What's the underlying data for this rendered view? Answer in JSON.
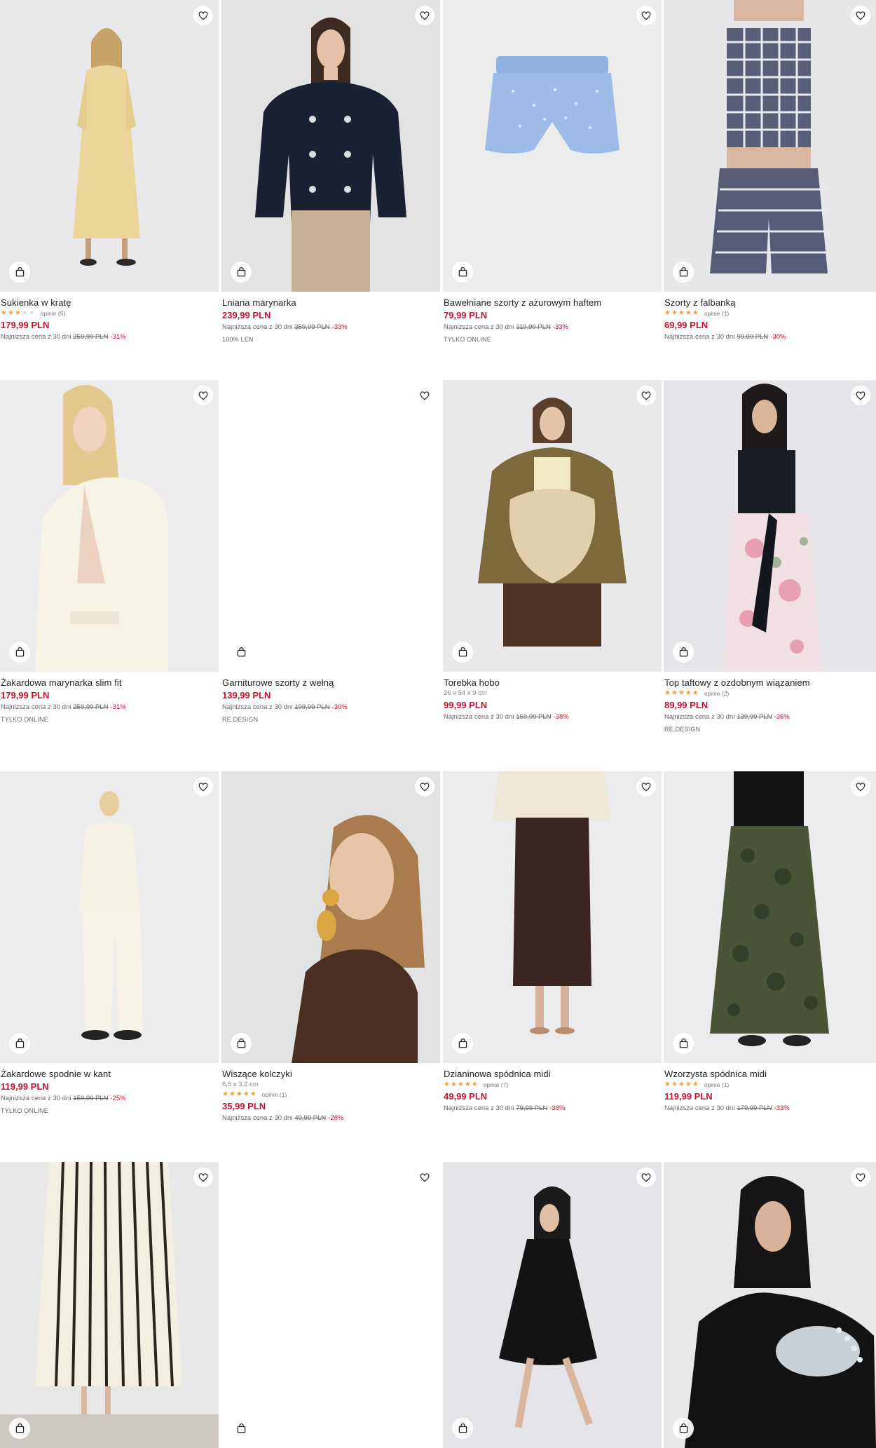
{
  "colors": {
    "price": "#c8102e",
    "star": "#f2a13b",
    "star_empty": "#d9d9d9"
  },
  "icons": {
    "favorite": "heart-icon",
    "add_to_bag": "shopping-bag-icon"
  },
  "products": [
    {
      "name": "Sukienka w kratę",
      "rating": 3.5,
      "reviews": "opinie (5)",
      "price": "179,99 PLN",
      "lowest_label": "Najniższa cena z 30 dni",
      "old_price": "259,99 PLN",
      "discount": "-31%"
    },
    {
      "name": "Lniana marynarka",
      "price": "239,99 PLN",
      "lowest_label": "Najniższa cena z 30 dni",
      "old_price": "359,99 PLN",
      "discount": "-33%",
      "tag": "100% LEN"
    },
    {
      "name": "Bawełniane szorty z ażurowym haftem",
      "price": "79,99 PLN",
      "lowest_label": "Najniższa cena z 30 dni",
      "old_price": "119,99 PLN",
      "discount": "-33%",
      "tag": "TYLKO ONLINE"
    },
    {
      "name": "Szorty z falbanką",
      "rating": 5,
      "reviews": "opinie (1)",
      "price": "69,99 PLN",
      "lowest_label": "Najniższa cena z 30 dni",
      "old_price": "99,99 PLN",
      "discount": "-30%"
    },
    {
      "name": "Żakardowa marynarka slim fit",
      "price": "179,99 PLN",
      "lowest_label": "Najniższa cena z 30 dni",
      "old_price": "259,99 PLN",
      "discount": "-31%",
      "tag": "TYLKO ONLINE"
    },
    {
      "name": "Garniturowe szorty z wełną",
      "price": "139,99 PLN",
      "lowest_label": "Najniższa cena z 30 dni",
      "old_price": "199,99 PLN",
      "discount": "-30%",
      "tag": "RE.DESIGN"
    },
    {
      "name": "Torebka hobo",
      "dims": "26 x 54 x 9 cm",
      "price": "99,99 PLN",
      "lowest_label": "Najniższa cena z 30 dni",
      "old_price": "159,99 PLN",
      "discount": "-38%"
    },
    {
      "name": "Top taftowy z ozdobnym wiązaniem",
      "rating": 5,
      "reviews": "opinie (2)",
      "price": "89,99 PLN",
      "lowest_label": "Najniższa cena z 30 dni",
      "old_price": "139,99 PLN",
      "discount": "-36%",
      "tag": "RE.DESIGN"
    },
    {
      "name": "Żakardowe spodnie w kant",
      "price": "119,99 PLN",
      "lowest_label": "Najniższa cena z 30 dni",
      "old_price": "159,99 PLN",
      "discount": "-25%",
      "tag": "TYLKO ONLINE"
    },
    {
      "name": "Wiszące kolczyki",
      "dims": "6,6 x 3,2 cm",
      "rating": 5,
      "reviews": "opinie (1)",
      "price": "35,99 PLN",
      "lowest_label": "Najniższa cena z 30 dni",
      "old_price": "49,99 PLN",
      "discount": "-28%"
    },
    {
      "name": "Dzianinowa spódnica midi",
      "rating": 5,
      "reviews": "opinie (7)",
      "price": "49,99 PLN",
      "lowest_label": "Najniższa cena z 30 dni",
      "old_price": "79,99 PLN",
      "discount": "-38%"
    },
    {
      "name": "Wzorzysta spódnica midi",
      "rating": 5,
      "reviews": "opinie (1)",
      "price": "119,99 PLN",
      "lowest_label": "Najniższa cena z 30 dni",
      "old_price": "179,99 PLN",
      "discount": "-33%"
    },
    {
      "name": ""
    },
    {
      "name": ""
    },
    {
      "name": ""
    },
    {
      "name": ""
    }
  ]
}
